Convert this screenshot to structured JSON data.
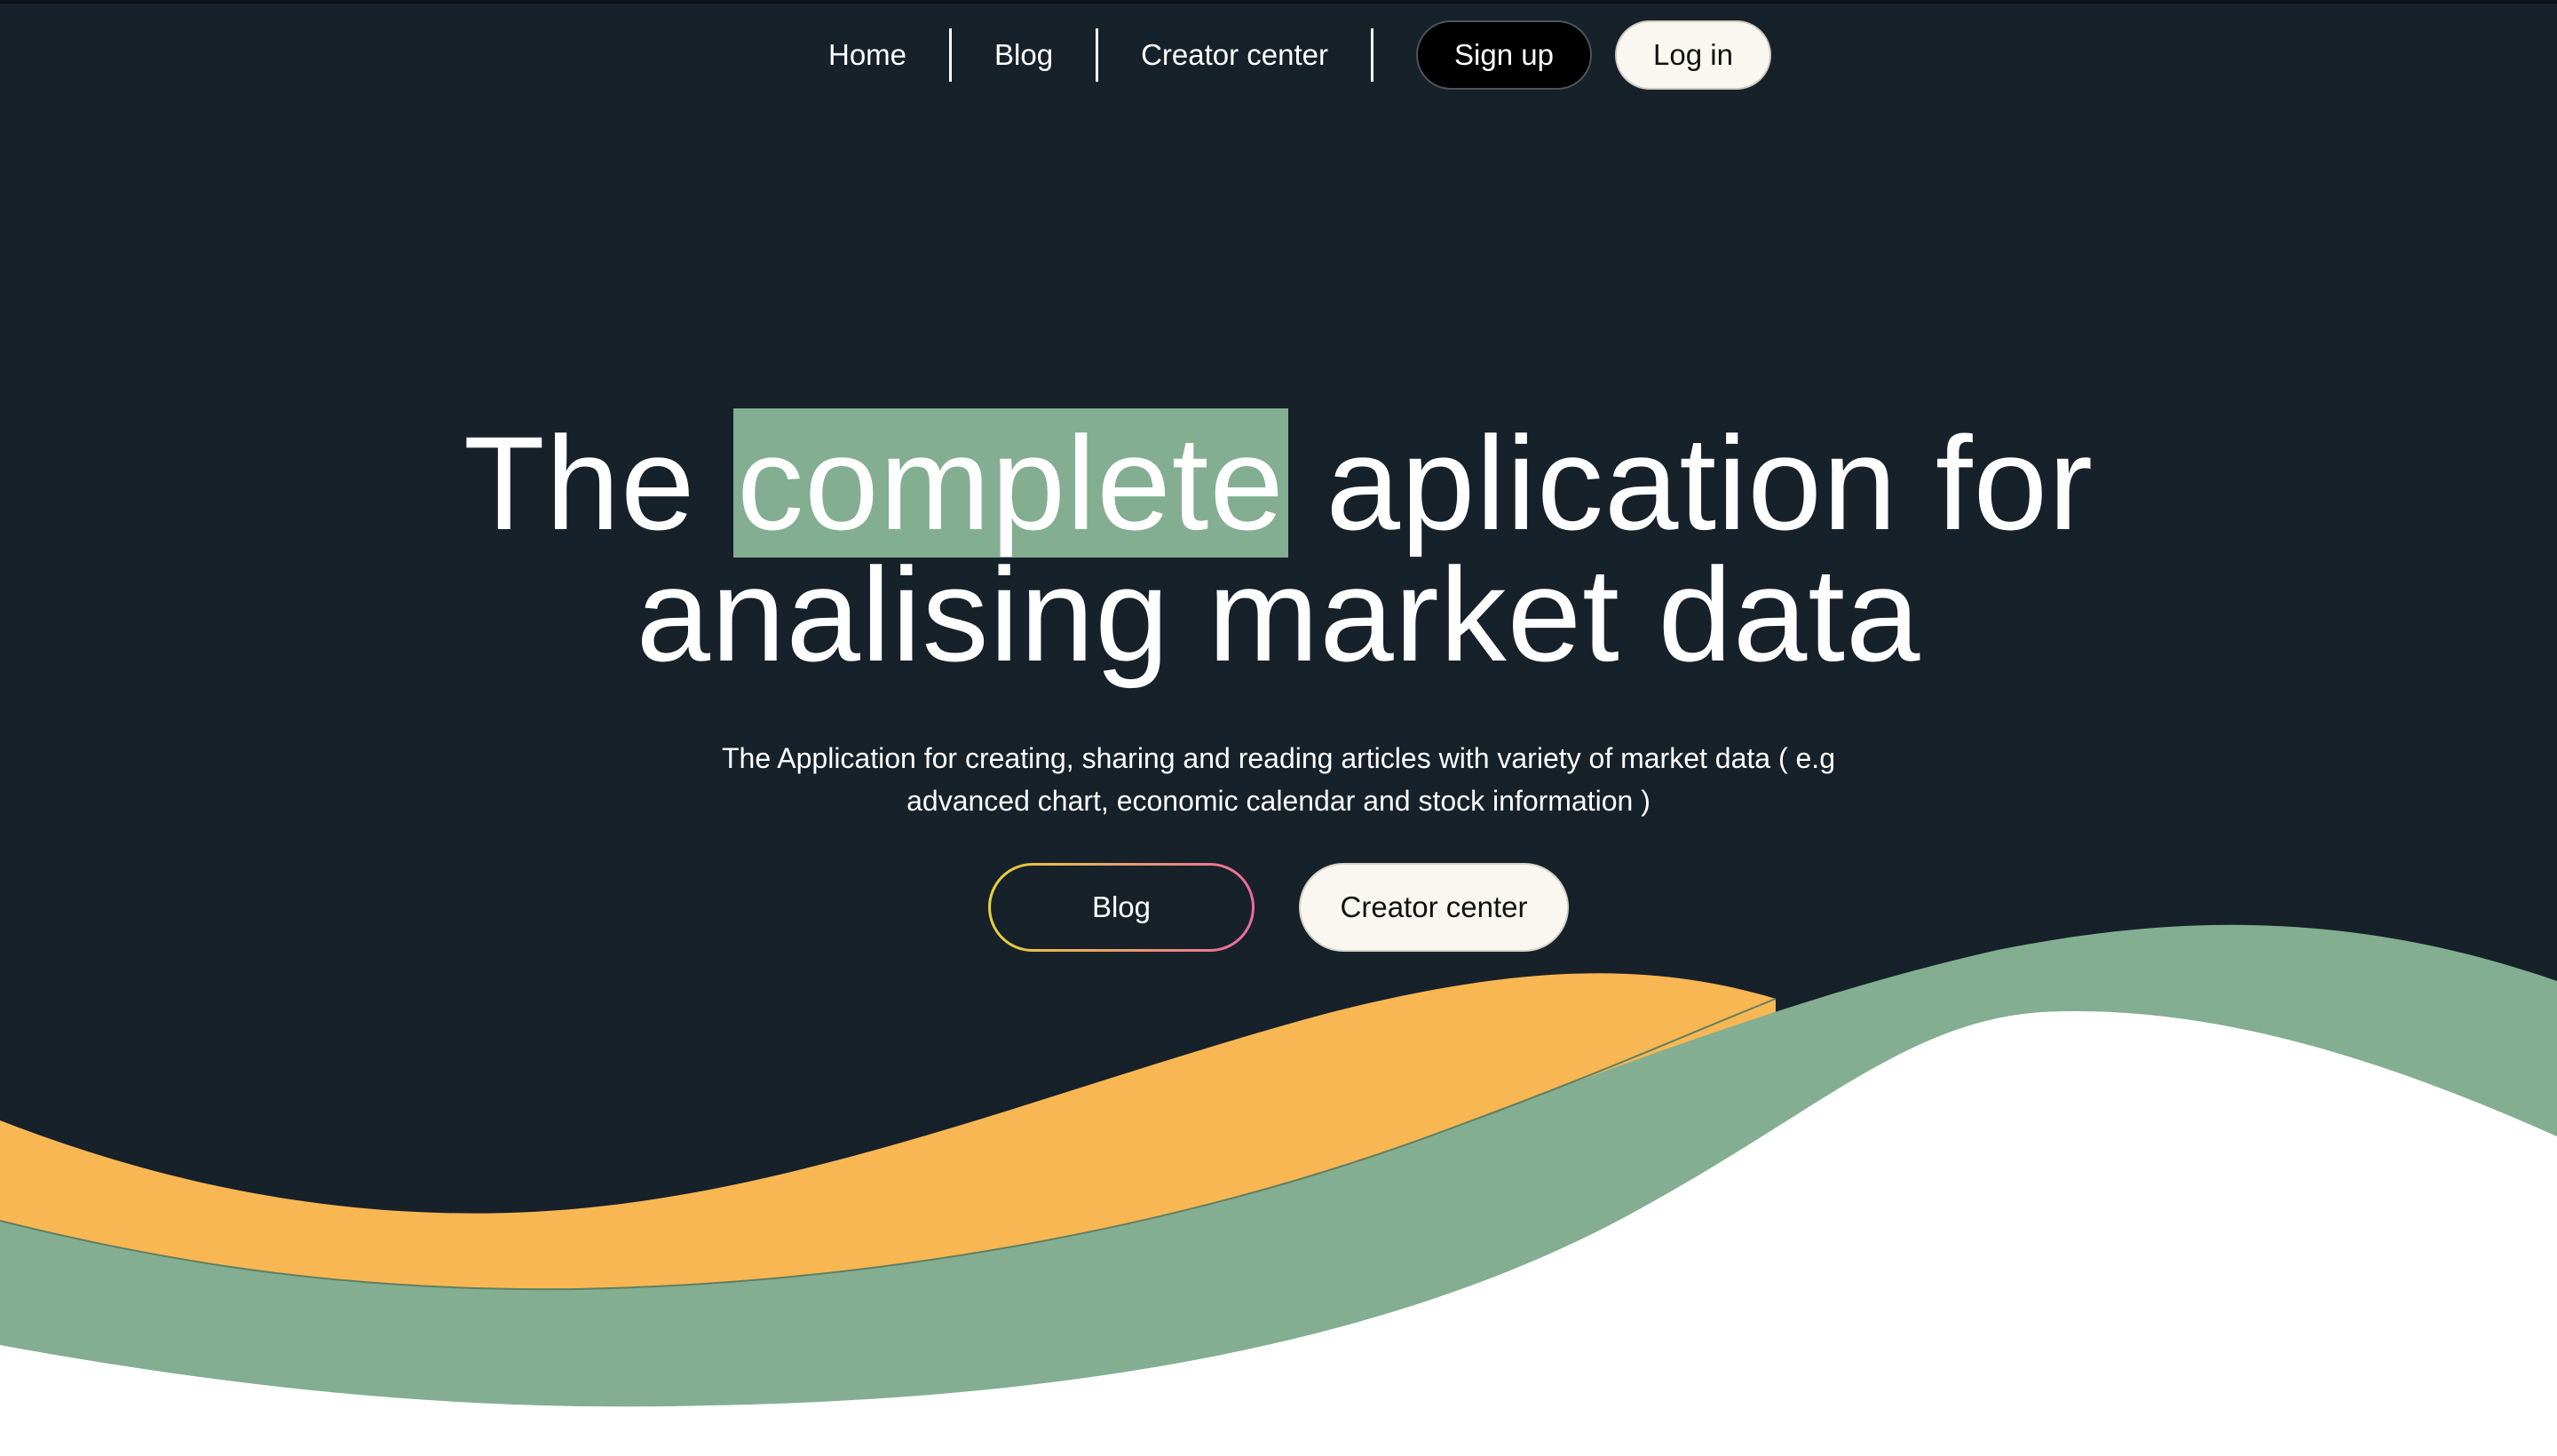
{
  "nav": {
    "links": [
      "Home",
      "Blog",
      "Creator center"
    ],
    "signup_label": "Sign up",
    "login_label": "Log in"
  },
  "hero": {
    "title_before": "The ",
    "title_highlight": "complete",
    "title_after_line1": " aplication for",
    "title_line2": "analising market data",
    "subtitle": "The Application for creating, sharing and reading articles with variety of market data ( e.g advanced chart, economic calendar and stock information )",
    "cta_blog_label": "Blog",
    "cta_creator_label": "Creator center"
  },
  "colors": {
    "background": "#17212a",
    "highlight": "#83ae91",
    "wave_orange": "#f8b752",
    "wave_green": "#83ae91",
    "wave_white": "#ffffff",
    "button_light": "#faf7f0",
    "button_dark": "#000000"
  }
}
